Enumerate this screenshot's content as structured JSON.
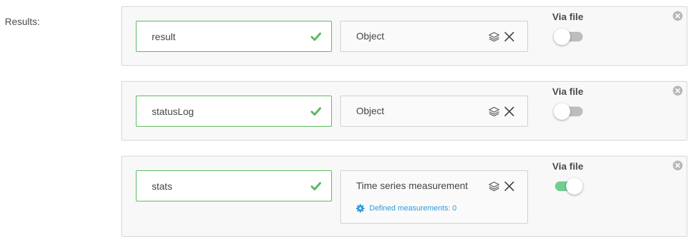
{
  "results_label": "Results:",
  "colors": {
    "valid": "#5cb85c",
    "link": "#2e9ad9",
    "toggle_on": "#6fcf8f",
    "toggle_off": "#bdbdbd"
  },
  "icons": {
    "valid": "check-icon",
    "type_picker": "layers-icon",
    "clear_type": "close-icon",
    "remove_row": "circle-close-icon",
    "measurements": "gear-icon"
  },
  "results": [
    {
      "name": "result",
      "type": "Object",
      "via_file_label": "Via file",
      "via_file": false
    },
    {
      "name": "statusLog",
      "type": "Object",
      "via_file_label": "Via file",
      "via_file": false
    },
    {
      "name": "stats",
      "type": "Time series measurement",
      "via_file_label": "Via file",
      "via_file": true,
      "measurements_link": "Defined measurements: 0"
    }
  ]
}
